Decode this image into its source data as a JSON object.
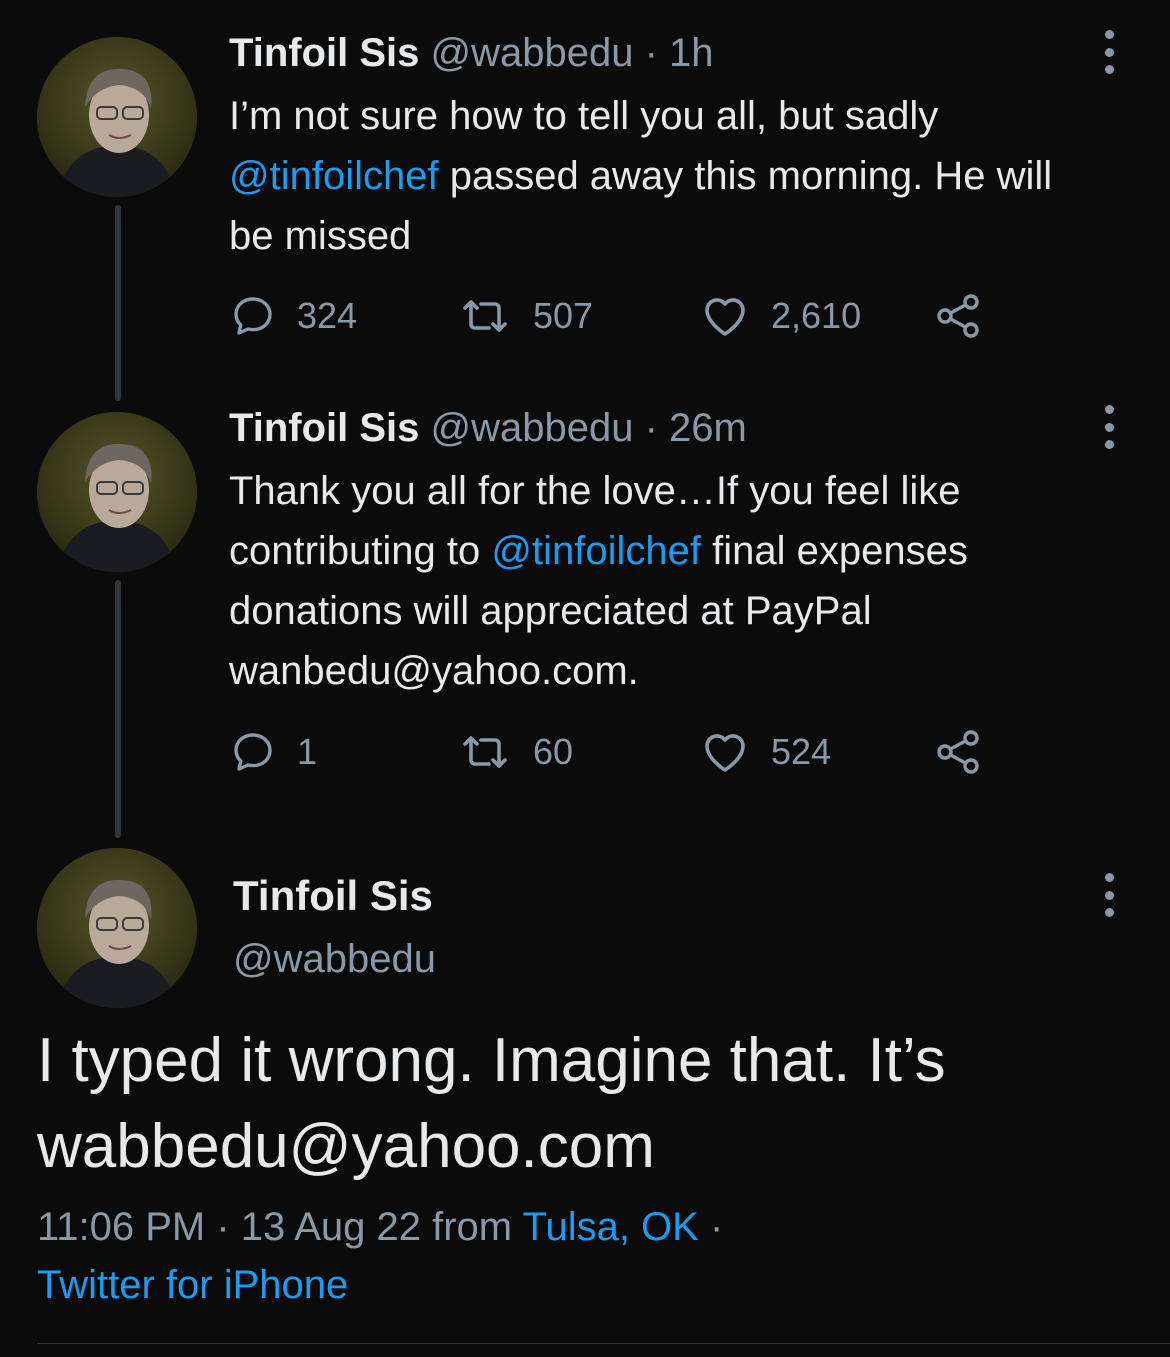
{
  "tweets": [
    {
      "name": "Tinfoil Sis",
      "handle": "@wabbedu",
      "sep": " · ",
      "time": "1h",
      "text_1": "I’m not sure how to tell you all, but sadly ",
      "mention": "@tinfoilchef",
      "text_2": " passed away this morning. He will be missed",
      "replies": "324",
      "retweets": "507",
      "likes": "2,610"
    },
    {
      "name": "Tinfoil Sis",
      "handle": "@wabbedu",
      "sep": " · ",
      "time": "26m",
      "text_1": "Thank you all for the love…If you feel like contributing to ",
      "mention": "@tinfoilchef",
      "text_2": " final expenses donations will appreciated at PayPal wanbedu@yahoo.com.",
      "replies": "1",
      "retweets": "60",
      "likes": "524"
    }
  ],
  "main_tweet": {
    "name": "Tinfoil Sis",
    "handle": "@wabbedu",
    "text": "I typed it wrong. Imagine that. It’s wabbedu@yahoo.com",
    "time": "11:06 PM",
    "sep1": " · ",
    "date": "13 Aug 22",
    "from_label": " from ",
    "location": "Tulsa, OK",
    "sep2": " ·",
    "source": "Twitter for iPhone"
  },
  "icons": [
    "more-options-icon",
    "reply-icon",
    "retweet-icon",
    "like-icon",
    "share-icon"
  ],
  "colors": {
    "background": "#0b0b0c",
    "text": "#e7e9ea",
    "muted": "#8b98a5",
    "link": "#1d9bf0"
  }
}
